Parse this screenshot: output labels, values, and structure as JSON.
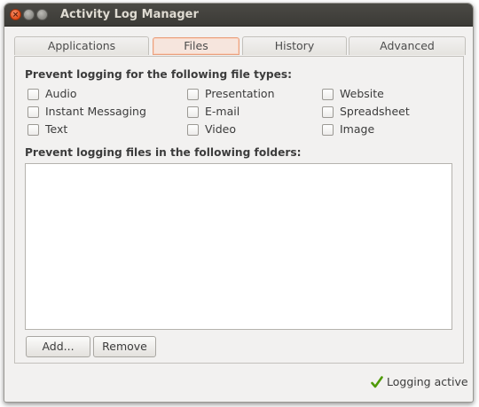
{
  "window": {
    "title": "Activity Log Manager",
    "buttons": [
      "close",
      "minimize",
      "maximize"
    ]
  },
  "tabs": [
    {
      "label": "Applications",
      "active": false
    },
    {
      "label": "Files",
      "active": true
    },
    {
      "label": "History",
      "active": false
    },
    {
      "label": "Advanced",
      "active": false
    }
  ],
  "file_types": {
    "heading": "Prevent logging for the following file types:",
    "items": [
      {
        "label": "Audio",
        "checked": false
      },
      {
        "label": "Presentation",
        "checked": false
      },
      {
        "label": "Website",
        "checked": false
      },
      {
        "label": "Instant Messaging",
        "checked": false
      },
      {
        "label": "E-mail",
        "checked": false
      },
      {
        "label": "Spreadsheet",
        "checked": false
      },
      {
        "label": "Text",
        "checked": false
      },
      {
        "label": "Video",
        "checked": false
      },
      {
        "label": "Image",
        "checked": false
      }
    ]
  },
  "folders": {
    "heading": "Prevent logging files in the following folders:",
    "add_label": "Add...",
    "remove_label": "Remove"
  },
  "status": {
    "label": "Logging active",
    "icon": "checkmark-icon",
    "color": "#4e9a06"
  },
  "colors": {
    "titlebar": "#3c3b37",
    "active_tab": "#f6e5dd",
    "close_button": "#df4a16"
  }
}
